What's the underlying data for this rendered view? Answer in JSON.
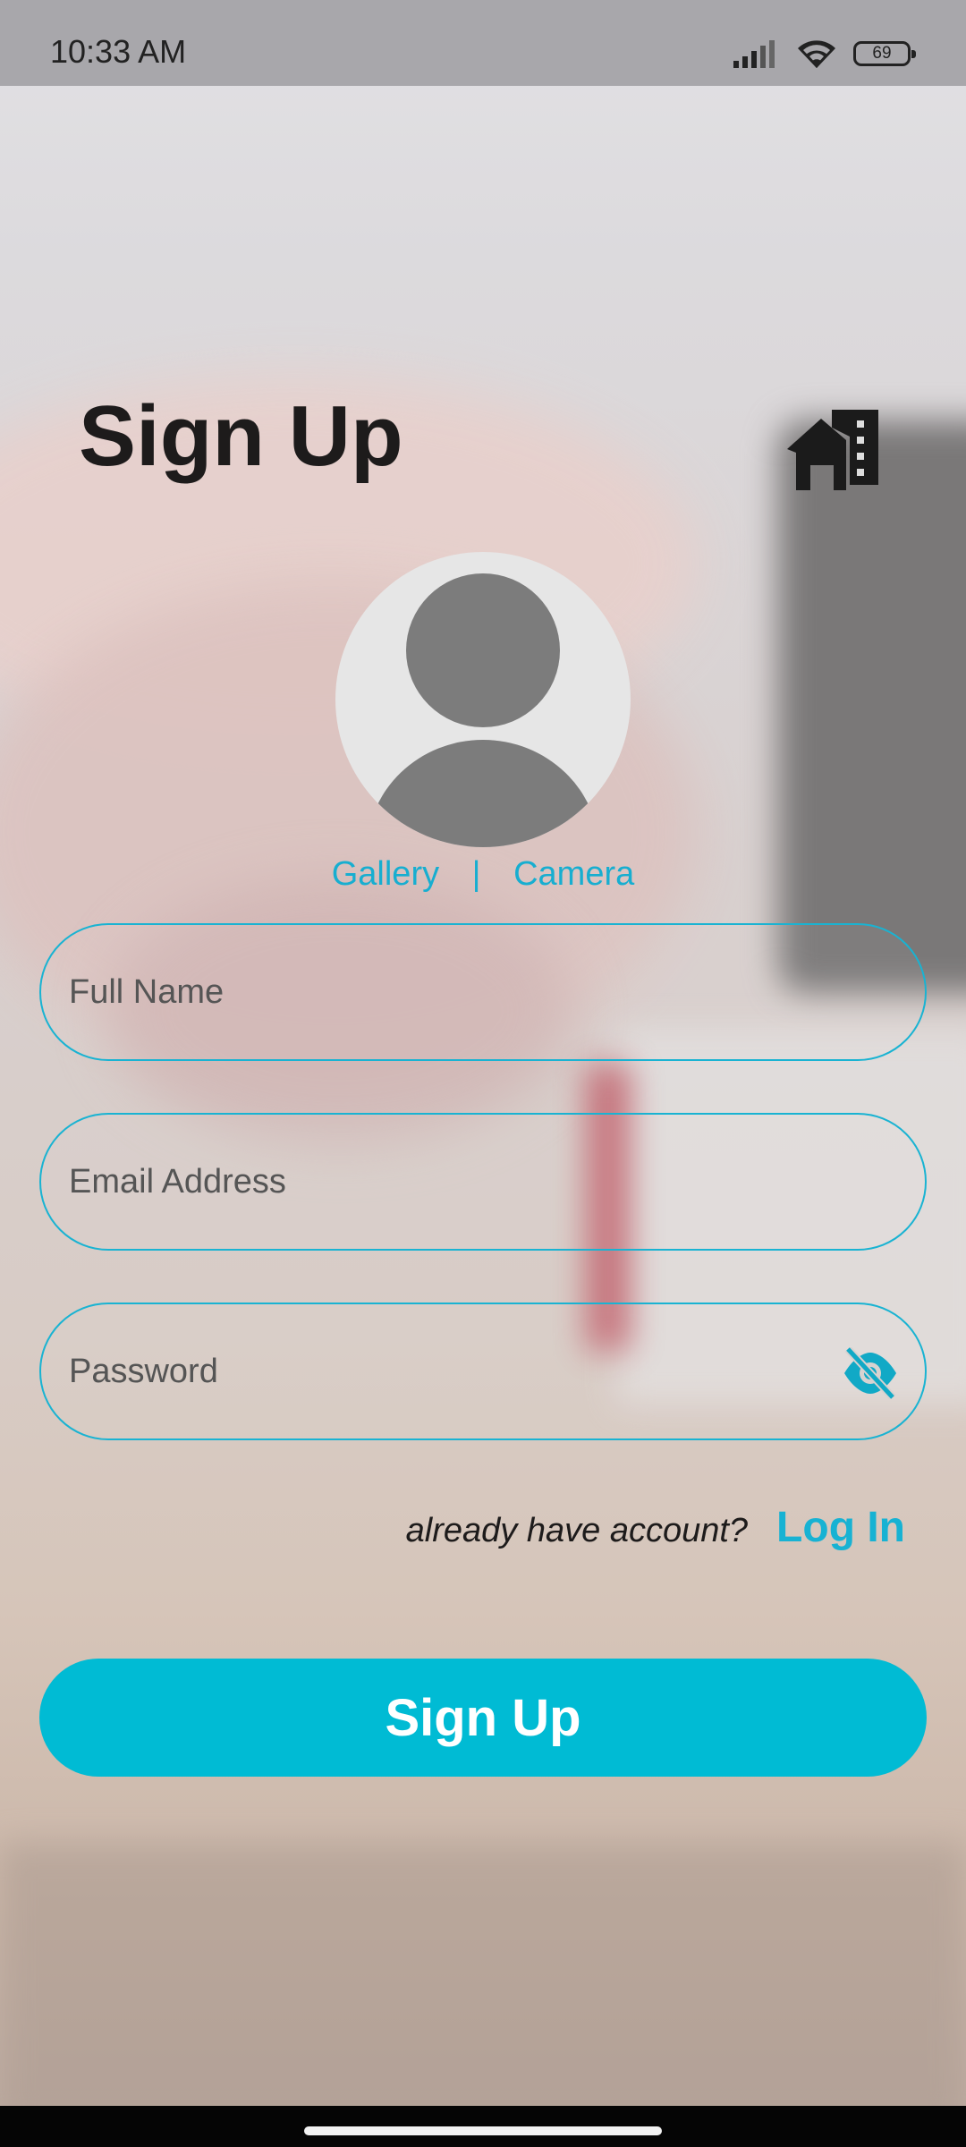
{
  "status_bar": {
    "time": "10:33 AM",
    "battery": "69"
  },
  "header": {
    "title": "Sign Up",
    "home_icon": "home-building-icon"
  },
  "avatar": {
    "icon": "person-avatar-icon"
  },
  "photo_source": {
    "gallery": "Gallery",
    "separator": "|",
    "camera": "Camera"
  },
  "form": {
    "full_name": {
      "placeholder": "Full Name",
      "value": ""
    },
    "email": {
      "placeholder": "Email Address",
      "value": ""
    },
    "password": {
      "placeholder": "Password",
      "value": "",
      "toggle_icon": "eye-off-icon"
    }
  },
  "login": {
    "prompt": "already have account?",
    "link": "Log In"
  },
  "signup_button": "Sign Up",
  "colors": {
    "accent": "#00BBD4",
    "link": "#17B2D3",
    "title": "#1D1B1B"
  }
}
